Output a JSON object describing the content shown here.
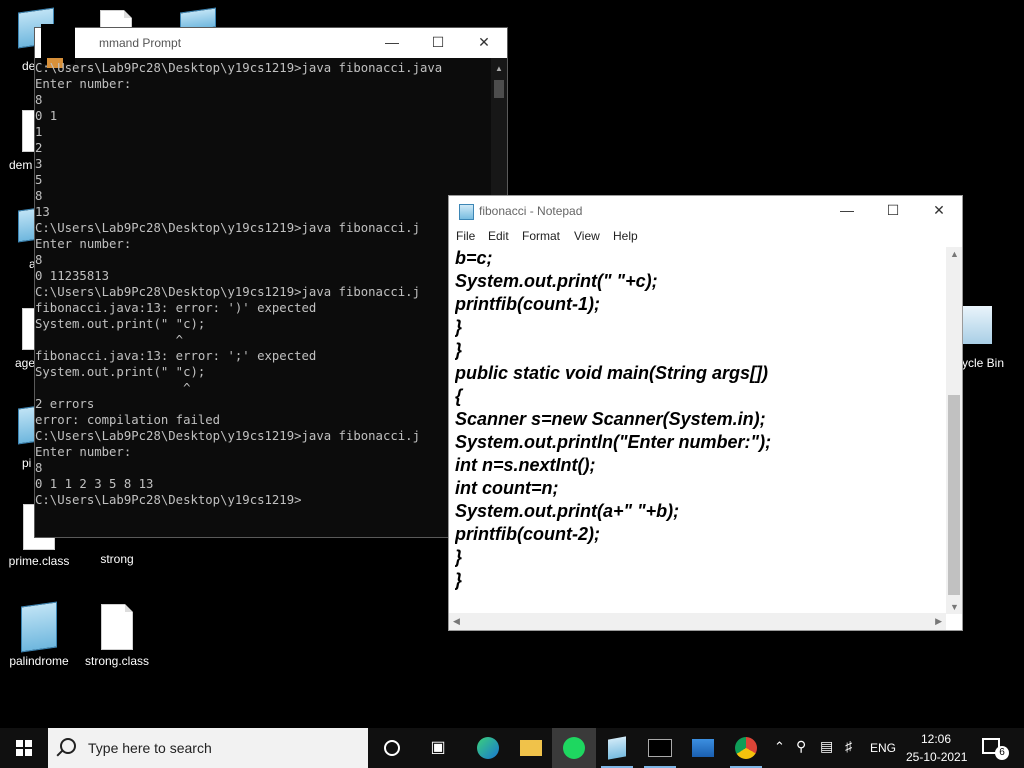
{
  "desktop": {
    "icons": [
      {
        "label": "prime.class"
      },
      {
        "label": "strong"
      },
      {
        "label": "palindrome"
      },
      {
        "label": "strong.class"
      }
    ],
    "partial_labels": [
      "de",
      "dem",
      "a",
      "age",
      "pi",
      "ycle Bin"
    ]
  },
  "cmd": {
    "title": "mmand Prompt",
    "lines": [
      "C:\\Users\\Lab9Pc28\\Desktop\\y19cs1219>java fibonacci.java",
      "Enter number:",
      "8",
      "0 1",
      "1",
      "2",
      "3",
      "5",
      "8",
      "13",
      "",
      "C:\\Users\\Lab9Pc28\\Desktop\\y19cs1219>java fibonacci.j",
      "Enter number:",
      "8",
      "0 11235813",
      "C:\\Users\\Lab9Pc28\\Desktop\\y19cs1219>java fibonacci.j",
      "fibonacci.java:13: error: ')' expected",
      "System.out.print(\" \"c);",
      "                   ^",
      "fibonacci.java:13: error: ';' expected",
      "System.out.print(\" \"c);",
      "                    ^",
      "2 errors",
      "error: compilation failed",
      "",
      "C:\\Users\\Lab9Pc28\\Desktop\\y19cs1219>java fibonacci.j",
      "Enter number:",
      "8",
      "0 1 1 2 3 5 8 13",
      "C:\\Users\\Lab9Pc28\\Desktop\\y19cs1219>"
    ]
  },
  "notepad": {
    "title": "fibonacci - Notepad",
    "menu": [
      "File",
      "Edit",
      "Format",
      "View",
      "Help"
    ],
    "lines": [
      "b=c;",
      "System.out.print(\" \"+c);",
      "printfib(count-1);",
      "}",
      "}",
      "public static void main(String args[])",
      "{",
      "Scanner s=new Scanner(System.in);",
      "System.out.println(\"Enter number:\");",
      "int n=s.nextInt();",
      "int count=n;",
      "System.out.print(a+\" \"+b);",
      "printfib(count-2);",
      "}",
      "}"
    ]
  },
  "taskbar": {
    "search_placeholder": "Type here to search",
    "language": "ENG",
    "time": "12:06",
    "date": "25-10-2021",
    "notification_count": "6"
  }
}
